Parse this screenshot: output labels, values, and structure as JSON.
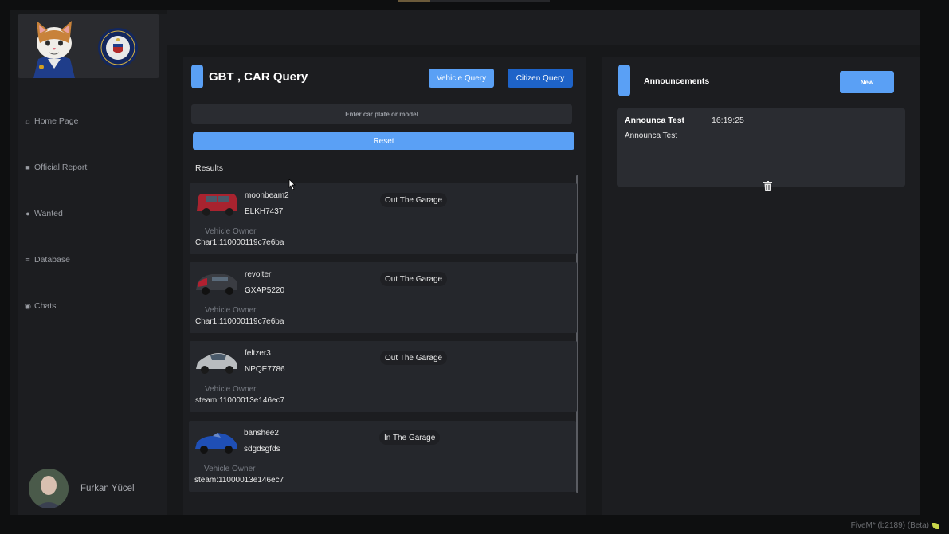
{
  "sidebar": {
    "items": [
      {
        "label": "Home Page",
        "icon": "home-icon"
      },
      {
        "label": "Official Report",
        "icon": "folder-icon"
      },
      {
        "label": "Wanted",
        "icon": "user-icon"
      },
      {
        "label": "Database",
        "icon": "database-icon"
      },
      {
        "label": "Chats",
        "icon": "chat-icon"
      }
    ],
    "profile_name": "Furkan Yücel"
  },
  "query": {
    "title": "GBT , CAR Query",
    "vehicle_query_label": "Vehicle Query",
    "citizen_query_label": "Citizen Query",
    "search_placeholder": "Enter car plate or model",
    "search_value": "",
    "reset_label": "Reset",
    "results_label": "Results",
    "owner_label": "Vehicle Owner",
    "results": [
      {
        "model": "moonbeam2",
        "plate": "ELKH7437",
        "status": "Out The Garage",
        "owner": "Char1:110000119c7e6ba",
        "car_color": "#a8232f"
      },
      {
        "model": "revolter",
        "plate": "GXAP5220",
        "status": "Out The Garage",
        "owner": "Char1:110000119c7e6ba",
        "car_color": "#3a3c42"
      },
      {
        "model": "feltzer3",
        "plate": "NPQE7786",
        "status": "Out The Garage",
        "owner": "steam:11000013e146ec7",
        "car_color": "#b9bcbf"
      },
      {
        "model": "banshee2",
        "plate": "sdgdsgfds",
        "status": "In The Garage",
        "owner": "steam:11000013e146ec7",
        "car_color": "#1f4fb5"
      }
    ]
  },
  "announcements": {
    "title": "Announcements",
    "new_label": "New",
    "items": [
      {
        "title": "Announca Test",
        "time": "16:19:25",
        "body": "Announca Test"
      }
    ]
  },
  "footer": {
    "text": "FiveM* (b2189) (Beta)"
  },
  "colors": {
    "accent": "#5aa0f5",
    "accent_dark": "#1e63c8",
    "panel": "#1c1d20",
    "card": "#25272c"
  }
}
